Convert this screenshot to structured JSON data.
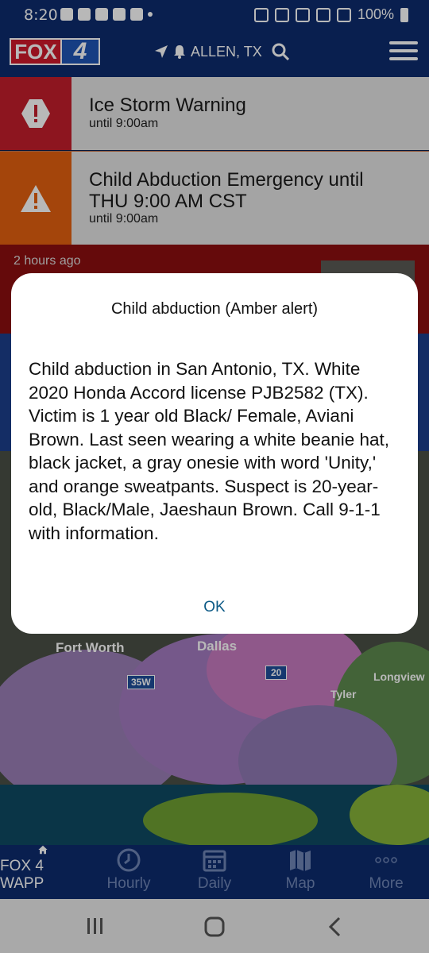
{
  "status_bar": {
    "time": "8:20",
    "battery": "100%"
  },
  "header": {
    "logo_left": "FOX",
    "logo_right": "4",
    "location": "ALLEN, TX"
  },
  "alerts": [
    {
      "title": "Ice Storm Warning",
      "subtitle": "until 9:00am",
      "color": "#c41e2c"
    },
    {
      "title": "Child Abduction Emergency until THU 9:00 AM CST",
      "subtitle": "until 9:00am",
      "color": "#e46010"
    }
  ],
  "news": {
    "time_ago": "2 hours ago"
  },
  "map": {
    "labels": [
      "Fort Worth",
      "Dallas",
      "Tyler",
      "Longview",
      "35W",
      "20"
    ]
  },
  "dialog": {
    "title": "Child abduction (Amber alert)",
    "body": "Child abduction in San Antonio, TX. White 2020 Honda Accord license PJB2582 (TX). Victim is 1 year old Black/ Female, Aviani Brown. Last seen wearing a white beanie hat, black jacket, a gray onesie with word 'Unity,' and orange sweatpants. Suspect is 20-year-old, Black/Male, Jaeshaun Brown. Call 9-1-1 with information.",
    "ok_label": "OK"
  },
  "bottom_nav": [
    {
      "label": "FOX 4 WAPP",
      "icon": "home-icon",
      "active": true
    },
    {
      "label": "Hourly",
      "icon": "clock-icon",
      "active": false
    },
    {
      "label": "Daily",
      "icon": "calendar-icon",
      "active": false
    },
    {
      "label": "Map",
      "icon": "map-icon",
      "active": false
    },
    {
      "label": "More",
      "icon": "more-dots-icon",
      "active": false
    }
  ]
}
